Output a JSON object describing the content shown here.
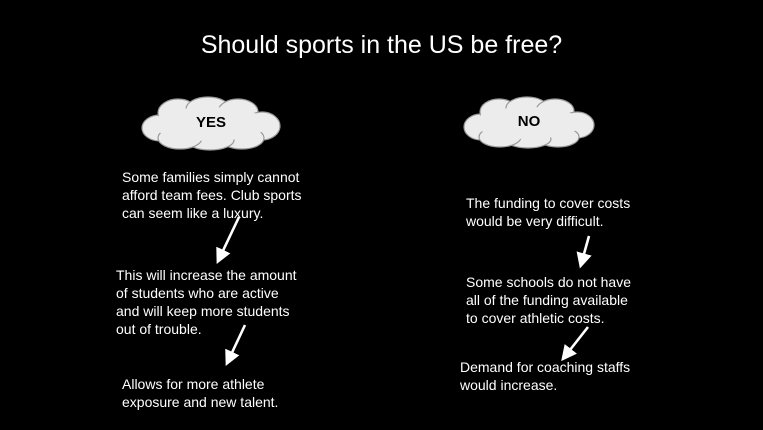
{
  "title": "Should sports in the US be free?",
  "colors": {
    "background": "#000000",
    "text": "#ffffff",
    "cloud_fill": "#ececec",
    "cloud_stroke": "#9a9a9a",
    "cloud_text": "#000000"
  },
  "yes": {
    "label": "YES",
    "points": [
      [
        "Some families simply cannot",
        "afford team fees. Club sports",
        "can seem like a luxury."
      ],
      [
        "This will increase the amount",
        "of students who are active",
        "and will keep more students",
        "out of trouble."
      ],
      [
        "Allows for more athlete",
        "exposure and new talent."
      ]
    ]
  },
  "no": {
    "label": "NO",
    "points": [
      [
        "The funding to cover costs",
        "would be very difficult."
      ],
      [
        "Some schools do not have",
        "all of the funding available",
        "to cover athletic costs."
      ],
      [
        "Demand for coaching staffs",
        "would increase."
      ]
    ]
  }
}
